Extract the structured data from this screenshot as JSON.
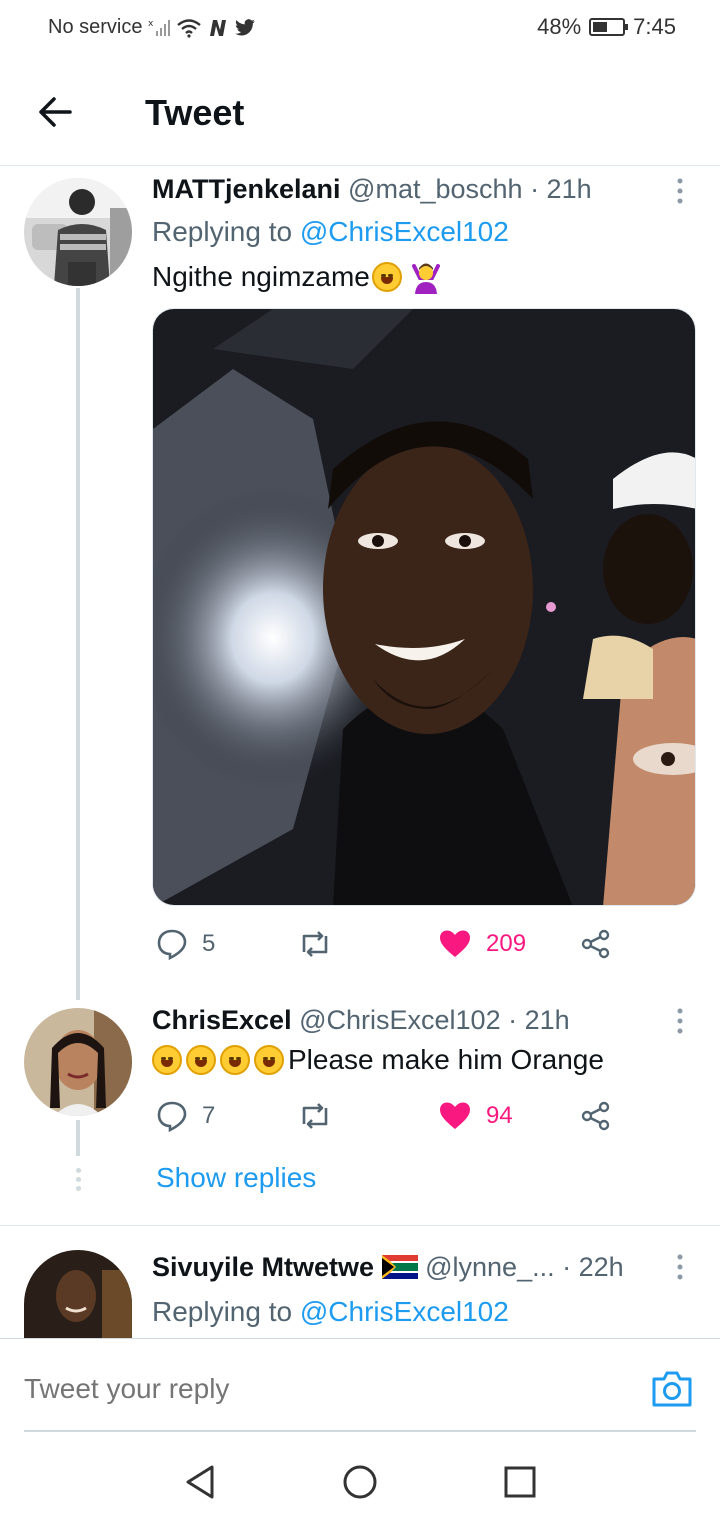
{
  "status_bar": {
    "carrier": "No service",
    "battery": "48%",
    "battery_level": 0.48,
    "time": "7:45"
  },
  "header": {
    "title": "Tweet",
    "back_icon": "arrow-left-icon"
  },
  "tweets": [
    {
      "name": "MATTjenkelani",
      "handle": "@mat_boschh",
      "time": "· 21h",
      "replying_prefix": "Replying to ",
      "replying_to": "@ChrisExcel102",
      "text": "Ngithe ngimzame",
      "emojis": [
        "rofl-emoji",
        "person-gesturing-ok-emoji"
      ],
      "actions": {
        "replies": "5",
        "retweets": "",
        "likes": "209",
        "liked": true
      }
    },
    {
      "name": "ChrisExcel",
      "handle": "@ChrisExcel102",
      "time": "· 21h",
      "text": "Please make him Orange",
      "emojis": [
        "joy-emoji",
        "joy-emoji",
        "joy-emoji",
        "rofl-emoji"
      ],
      "actions": {
        "replies": "7",
        "retweets": "",
        "likes": "94",
        "liked": true
      },
      "show_replies": "Show replies"
    },
    {
      "name": "Sivuyile Mtwetwe",
      "flag": "south-africa-flag-emoji",
      "handle": "@lynne_...",
      "time": "· 22h",
      "replying_prefix": "Replying to ",
      "replying_to": "@ChrisExcel102"
    }
  ],
  "composer": {
    "placeholder": "Tweet your reply",
    "camera_icon": "camera-icon"
  },
  "colors": {
    "accent": "#1d9bf0",
    "like": "#f91880",
    "text": "#0f1419",
    "muted": "#536471"
  }
}
